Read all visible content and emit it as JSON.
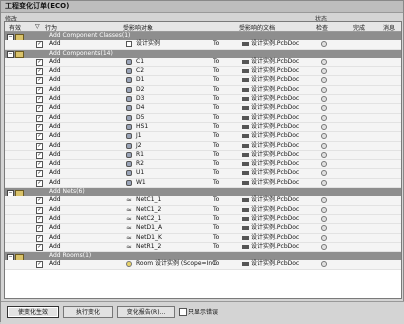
{
  "window": {
    "title": "工程变化订单(ECO)"
  },
  "toprow": {
    "modify": "修改",
    "status": "状态"
  },
  "columns": {
    "enable": "有效",
    "action": "行为",
    "affected_object": "受影响对象",
    "affected_doc": "受影响的文档",
    "check": "检查",
    "done": "完成",
    "message": "消息"
  },
  "groups": {
    "classes": {
      "label": "Add Component Classes(1)",
      "items": [
        {
          "action": "Add",
          "object": "设计实例",
          "to": "To",
          "doc": "设计实例.PcbDoc",
          "icon": "class-icon"
        }
      ]
    },
    "components": {
      "label": "Add Components(14)",
      "items": [
        {
          "action": "Add",
          "object": "C1",
          "to": "To",
          "doc": "设计实例.PcbDoc",
          "icon": "component-icon"
        },
        {
          "action": "Add",
          "object": "C2",
          "to": "To",
          "doc": "设计实例.PcbDoc",
          "icon": "component-icon"
        },
        {
          "action": "Add",
          "object": "D1",
          "to": "To",
          "doc": "设计实例.PcbDoc",
          "icon": "component-icon"
        },
        {
          "action": "Add",
          "object": "D2",
          "to": "To",
          "doc": "设计实例.PcbDoc",
          "icon": "component-icon"
        },
        {
          "action": "Add",
          "object": "D3",
          "to": "To",
          "doc": "设计实例.PcbDoc",
          "icon": "component-icon"
        },
        {
          "action": "Add",
          "object": "D4",
          "to": "To",
          "doc": "设计实例.PcbDoc",
          "icon": "component-icon"
        },
        {
          "action": "Add",
          "object": "D5",
          "to": "To",
          "doc": "设计实例.PcbDoc",
          "icon": "component-icon"
        },
        {
          "action": "Add",
          "object": "HS1",
          "to": "To",
          "doc": "设计实例.PcbDoc",
          "icon": "component-icon"
        },
        {
          "action": "Add",
          "object": "J1",
          "to": "To",
          "doc": "设计实例.PcbDoc",
          "icon": "component-icon"
        },
        {
          "action": "Add",
          "object": "J2",
          "to": "To",
          "doc": "设计实例.PcbDoc",
          "icon": "component-icon"
        },
        {
          "action": "Add",
          "object": "R1",
          "to": "To",
          "doc": "设计实例.PcbDoc",
          "icon": "component-icon"
        },
        {
          "action": "Add",
          "object": "R2",
          "to": "To",
          "doc": "设计实例.PcbDoc",
          "icon": "component-icon"
        },
        {
          "action": "Add",
          "object": "U1",
          "to": "To",
          "doc": "设计实例.PcbDoc",
          "icon": "component-icon"
        },
        {
          "action": "Add",
          "object": "W1",
          "to": "To",
          "doc": "设计实例.PcbDoc",
          "icon": "component-icon"
        }
      ]
    },
    "nets": {
      "label": "Add Nets(6)",
      "items": [
        {
          "action": "Add",
          "object": "NetC1_1",
          "to": "To",
          "doc": "设计实例.PcbDoc",
          "icon": "net-icon"
        },
        {
          "action": "Add",
          "object": "NetC1_2",
          "to": "To",
          "doc": "设计实例.PcbDoc",
          "icon": "net-icon"
        },
        {
          "action": "Add",
          "object": "NetC2_1",
          "to": "To",
          "doc": "设计实例.PcbDoc",
          "icon": "net-icon"
        },
        {
          "action": "Add",
          "object": "NetD1_A",
          "to": "To",
          "doc": "设计实例.PcbDoc",
          "icon": "net-icon"
        },
        {
          "action": "Add",
          "object": "NetD1_K",
          "to": "To",
          "doc": "设计实例.PcbDoc",
          "icon": "net-icon"
        },
        {
          "action": "Add",
          "object": "NetR1_2",
          "to": "To",
          "doc": "设计实例.PcbDoc",
          "icon": "net-icon"
        }
      ]
    },
    "rooms": {
      "label": "Add Rooms(1)",
      "items": [
        {
          "action": "Add",
          "object": "Room 设计实例 (Scope=InC",
          "to": "To",
          "doc": "设计实例.PcbDoc",
          "icon": "room-icon"
        }
      ]
    }
  },
  "buttons": {
    "validate": "使变化生效",
    "execute": "执行变化",
    "report": "变化报告(R)...",
    "only_errors": "只显示错误"
  }
}
